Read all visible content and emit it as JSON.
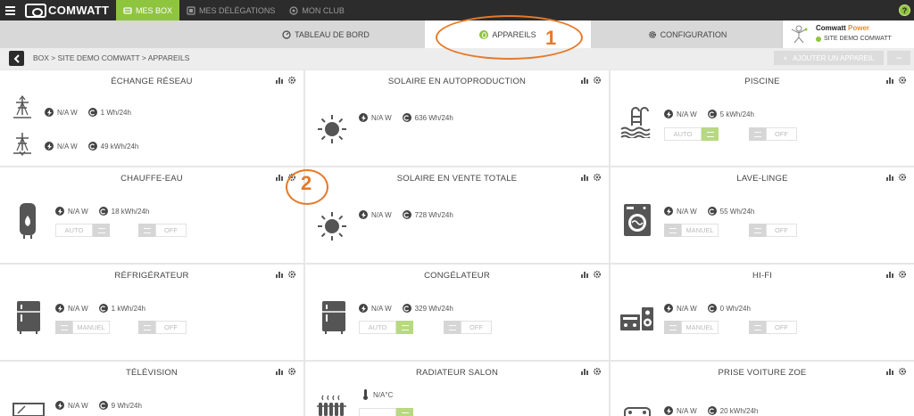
{
  "topbar": {
    "logo_text": "COMWATT",
    "nav": [
      {
        "label": "MES BOX",
        "icon": "box-icon",
        "active": true
      },
      {
        "label": "MES DÉLÉGATIONS",
        "icon": "delegation-icon",
        "active": false
      },
      {
        "label": "MON CLUB",
        "icon": "club-icon",
        "active": false
      }
    ],
    "help_label": "?"
  },
  "tabs": [
    {
      "label": "TABLEAU DE BORD",
      "icon": "dashboard-icon"
    },
    {
      "label": "APPAREILS",
      "icon": "appliance-icon",
      "active": true
    },
    {
      "label": "CONFIGURATION",
      "icon": "gear-icon"
    }
  ],
  "account": {
    "name": "Comwatt",
    "name_suffix": "Power",
    "site": "SITE DEMO COMWATT"
  },
  "breadcrumb": "BOX > SITE DEMO COMWATT > APPAREILS",
  "actions": {
    "add_label": "AJOUTER UN APPAREIL",
    "add_symbol": "+",
    "minus_symbol": "−"
  },
  "cards": {
    "echange": {
      "title": "ÉCHANGE RÉSEAU",
      "rows": [
        {
          "power": "N/A W",
          "energy": "1 Wh/24h"
        },
        {
          "power": "N/A W",
          "energy": "49 kWh/24h"
        }
      ]
    },
    "solaire_auto": {
      "title": "SOLAIRE EN AUTOPRODUCTION",
      "power": "N/A W",
      "energy": "636 Wh/24h"
    },
    "piscine": {
      "title": "PISCINE",
      "power": "N/A W",
      "energy": "5 kWh/24h",
      "mode": "AUTO",
      "off": "OFF"
    },
    "chauffe_eau": {
      "title": "CHAUFFE-EAU",
      "power": "N/A W",
      "energy": "18 kWh/24h",
      "mode": "AUTO",
      "off": "OFF"
    },
    "solaire_vente": {
      "title": "SOLAIRE EN VENTE TOTALE",
      "power": "N/A W",
      "energy": "728 Wh/24h"
    },
    "lave_linge": {
      "title": "LAVE-LINGE",
      "power": "N/A W",
      "energy": "55 Wh/24h",
      "mode": "MANUEL",
      "off": "OFF"
    },
    "refrigerateur": {
      "title": "RÉFRIGÉRATEUR",
      "power": "N/A W",
      "energy": "1 kWh/24h",
      "mode": "MANUEL",
      "off": "OFF"
    },
    "congelateur": {
      "title": "CONGÉLATEUR",
      "power": "N/A W",
      "energy": "329 Wh/24h",
      "mode": "AUTO",
      "off": "OFF"
    },
    "hifi": {
      "title": "HI-FI",
      "power": "N/A W",
      "energy": "0 Wh/24h",
      "mode": "MANUEL",
      "off": "OFF"
    },
    "television": {
      "title": "TÉLÉVISION",
      "power": "N/A W",
      "energy": "9 Wh/24h"
    },
    "radiateur": {
      "title": "RADIATEUR SALON",
      "temperature": "N/A°C"
    },
    "prise_zoe": {
      "title": "PRISE VOITURE ZOE",
      "power": "N/A W",
      "energy": "20 kWh/24h"
    }
  },
  "annotations": {
    "one": "1",
    "two": "2"
  },
  "colors": {
    "accent": "#8fc43f",
    "annotation": "#e57a2a",
    "topbar": "#2c2c2c"
  }
}
